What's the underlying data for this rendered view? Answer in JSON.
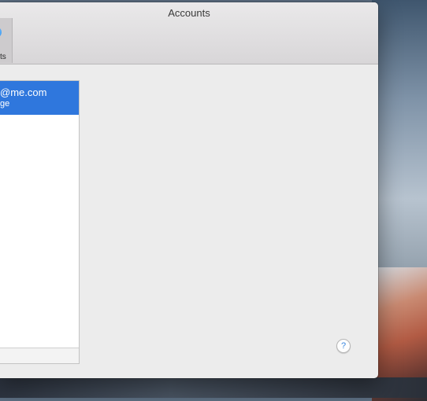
{
  "window": {
    "title": "Accounts"
  },
  "toolbar": {
    "items": [
      {
        "label": "ts",
        "icon": "accounts-icon",
        "selected": true
      }
    ]
  },
  "accounts_list": {
    "rows": [
      {
        "email": "@me.com",
        "description": "ge",
        "selected": true
      }
    ]
  },
  "help": {
    "label": "?"
  },
  "colors": {
    "selection": "#2f77dd",
    "window_bg": "#ececec"
  }
}
